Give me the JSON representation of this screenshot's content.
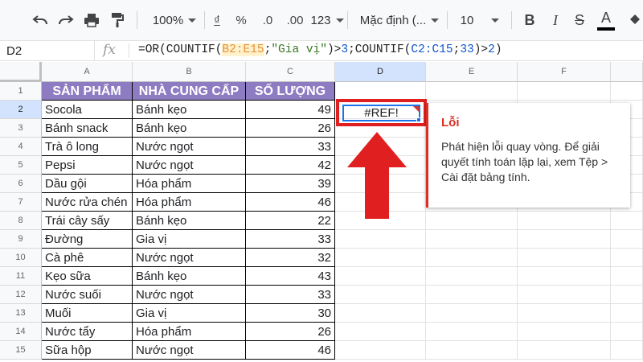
{
  "toolbar": {
    "zoom": "100%",
    "currency": "₫",
    "percent": "%",
    "dec_less": ".0",
    "dec_more": ".00",
    "more_formats": "123",
    "font_name": "Mặc định (...",
    "font_size": "10",
    "bold": "B",
    "italic": "I",
    "strike": "S",
    "text_color": "A"
  },
  "formula_bar": {
    "name_box": "D2",
    "fx": "fx",
    "f1": "=OR(COUNTIF(",
    "f2": "B2:E15",
    "f3": ";",
    "f4": "\"Gia vị\"",
    "f5": ")>",
    "f6": "3",
    "f7": ";COUNTIF(",
    "f8": "C2:C15",
    "f9": ";",
    "f10": "33",
    "f11": ")>",
    "f12": "2",
    "f13": ")"
  },
  "columns": [
    "A",
    "B",
    "C",
    "D",
    "E",
    "F"
  ],
  "rows": [
    "1",
    "2",
    "3",
    "4",
    "5",
    "6",
    "7",
    "8",
    "9",
    "10",
    "11",
    "12",
    "13",
    "14",
    "15"
  ],
  "table": {
    "headers": [
      "SẢN PHẨM",
      "NHÀ CUNG CẤP",
      "SỐ LƯỢNG"
    ],
    "rows": [
      [
        "Socola",
        "Bánh kẹo",
        "49"
      ],
      [
        "Bánh snack",
        "Bánh kẹo",
        "26"
      ],
      [
        "Trà ô long",
        "Nước ngọt",
        "33"
      ],
      [
        "Pepsi",
        "Nước ngọt",
        "42"
      ],
      [
        "Dầu gội",
        "Hóa phẩm",
        "39"
      ],
      [
        "Nước rửa chén",
        "Hóa phẩm",
        "46"
      ],
      [
        "Trái cây sấy",
        "Bánh kẹo",
        "22"
      ],
      [
        "Đường",
        "Gia vị",
        "33"
      ],
      [
        "Cà phê",
        "Nước ngọt",
        "32"
      ],
      [
        "Kẹo sữa",
        "Bánh kẹo",
        "43"
      ],
      [
        "Nước suối",
        "Nước ngọt",
        "33"
      ],
      [
        "Muối",
        "Gia vị",
        "30"
      ],
      [
        "Nước tẩy",
        "Hóa phẩm",
        "26"
      ],
      [
        "Sữa hộp",
        "Nước ngọt",
        "46"
      ]
    ]
  },
  "active_cell_value": "#REF!",
  "error_popup": {
    "title": "Lỗi",
    "message": "Phát hiện lỗi quay vòng. Để giải quyết tính toán lặp lại, xem Tệp > Cài đặt bảng tính."
  },
  "colors": {
    "header_fill": "#8e7cc3",
    "highlight_red": "#e02020",
    "selection_blue": "#1a73e8"
  }
}
